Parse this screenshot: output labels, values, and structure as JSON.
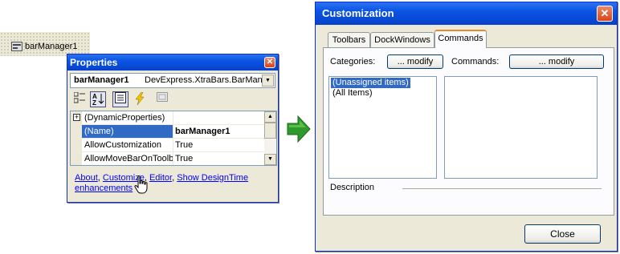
{
  "tray": {
    "label": "barManager1"
  },
  "properties": {
    "title": "Properties",
    "object_name": "barManager1",
    "object_type": "DevExpress.XtraBars.BarManager",
    "rows": [
      {
        "name": "(DynamicProperties)",
        "value": "",
        "expandable": true,
        "selected": false
      },
      {
        "name": "(Name)",
        "value": "barManager1",
        "expandable": false,
        "selected": true
      },
      {
        "name": "AllowCustomization",
        "value": "True",
        "expandable": false,
        "selected": false
      },
      {
        "name": "AllowMoveBarOnToolbar",
        "value": "True",
        "expandable": false,
        "selected": false
      }
    ],
    "commands": {
      "about": "About",
      "customize": "Customize",
      "editor": "Editor",
      "show_designtime": "Show DesignTime enhancements",
      "sep": ", "
    }
  },
  "customization": {
    "title": "Customization",
    "tabs": [
      "Toolbars",
      "DockWindows",
      "Commands"
    ],
    "active_tab": "Commands",
    "categories_label": "Categories:",
    "commands_label": "Commands:",
    "modify_label": "... modify",
    "categories": [
      "(Unassigned items)",
      "(All Items)"
    ],
    "selected_category": "(Unassigned items)",
    "description_label": "Description",
    "close_label": "Close"
  },
  "colors": {
    "title_blue": "#0a54e3",
    "selection": "#316ac5",
    "arrow_green": "#2e9a2e",
    "close_red": "#d8441c"
  }
}
